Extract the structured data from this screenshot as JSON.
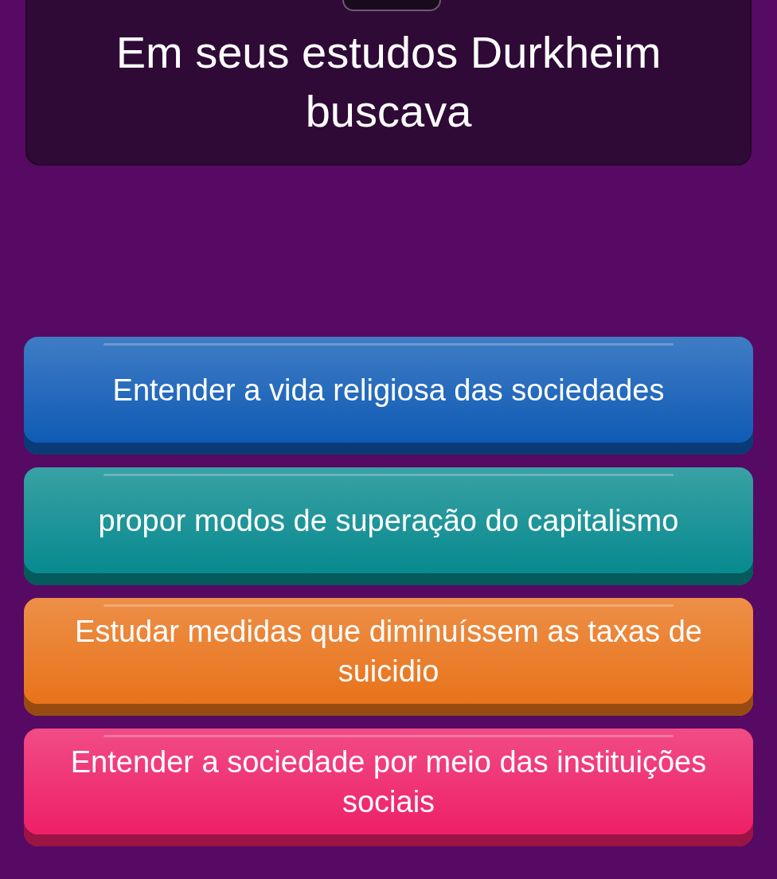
{
  "question": {
    "text": "Em seus estudos Durkheim buscava"
  },
  "options": [
    {
      "text": "Entender a vida religiosa das sociedades",
      "color": "#0f5bb5"
    },
    {
      "text": "propor modos de superação do capitalismo",
      "color": "#078a8e"
    },
    {
      "text": "Estudar medidas que diminuíssem as taxas de suicidio",
      "color": "#e8731a"
    },
    {
      "text": "Entender a sociedade por meio das instituições sociais",
      "color": "#ee1f67"
    }
  ]
}
